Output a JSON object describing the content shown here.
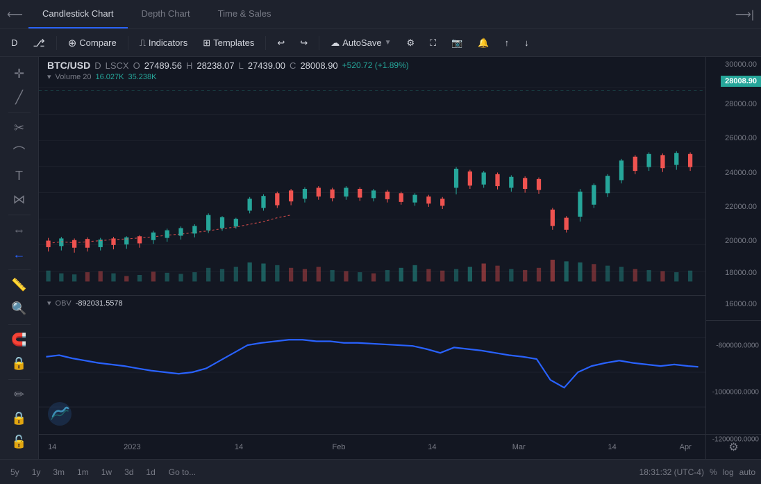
{
  "tabs": [
    {
      "label": "Candlestick Chart",
      "active": true
    },
    {
      "label": "Depth Chart",
      "active": false
    },
    {
      "label": "Time & Sales",
      "active": false
    }
  ],
  "toolbar": {
    "timeframe": "D",
    "compare_label": "Compare",
    "indicators_label": "Indicators",
    "templates_label": "Templates",
    "autosave_label": "AutoSave"
  },
  "symbol": {
    "name": "BTC/USD",
    "interval": "D",
    "exchange": "LSCX",
    "open_label": "O",
    "open_val": "27489.56",
    "high_label": "H",
    "high_val": "28238.07",
    "low_label": "L",
    "low_val": "27439.00",
    "close_label": "C",
    "close_val": "28008.90",
    "change": "+520.72 (+1.89%)",
    "volume_label": "Volume 20",
    "volume_val1": "16.027K",
    "volume_val2": "35.238K"
  },
  "obv": {
    "label": "OBV",
    "value": "-892031.5578"
  },
  "price_label": "28008.90",
  "scale": {
    "main": [
      "30000.00",
      "28000.00",
      "26000.00",
      "24000.00",
      "22000.00",
      "20000.00",
      "18000.00",
      "16000.00"
    ],
    "obv": [
      "-800000.0000",
      "-1000000.0000",
      "-1200000.0000"
    ]
  },
  "x_labels": [
    "14",
    "2023",
    "14",
    "Feb",
    "14",
    "Mar",
    "14",
    "Apr"
  ],
  "bottom_timeframes": [
    "5y",
    "1y",
    "3m",
    "1m",
    "1w",
    "3d",
    "1d"
  ],
  "goto_label": "Go to...",
  "timestamp": "18:31:32 (UTC-4)",
  "bottom_right": {
    "%": "%",
    "log": "log",
    "auto": "auto"
  },
  "colors": {
    "green": "#26a69a",
    "red": "#ef5350",
    "blue": "#2962ff",
    "bg": "#131722",
    "panel": "#1e222d",
    "border": "#2a2e39"
  }
}
